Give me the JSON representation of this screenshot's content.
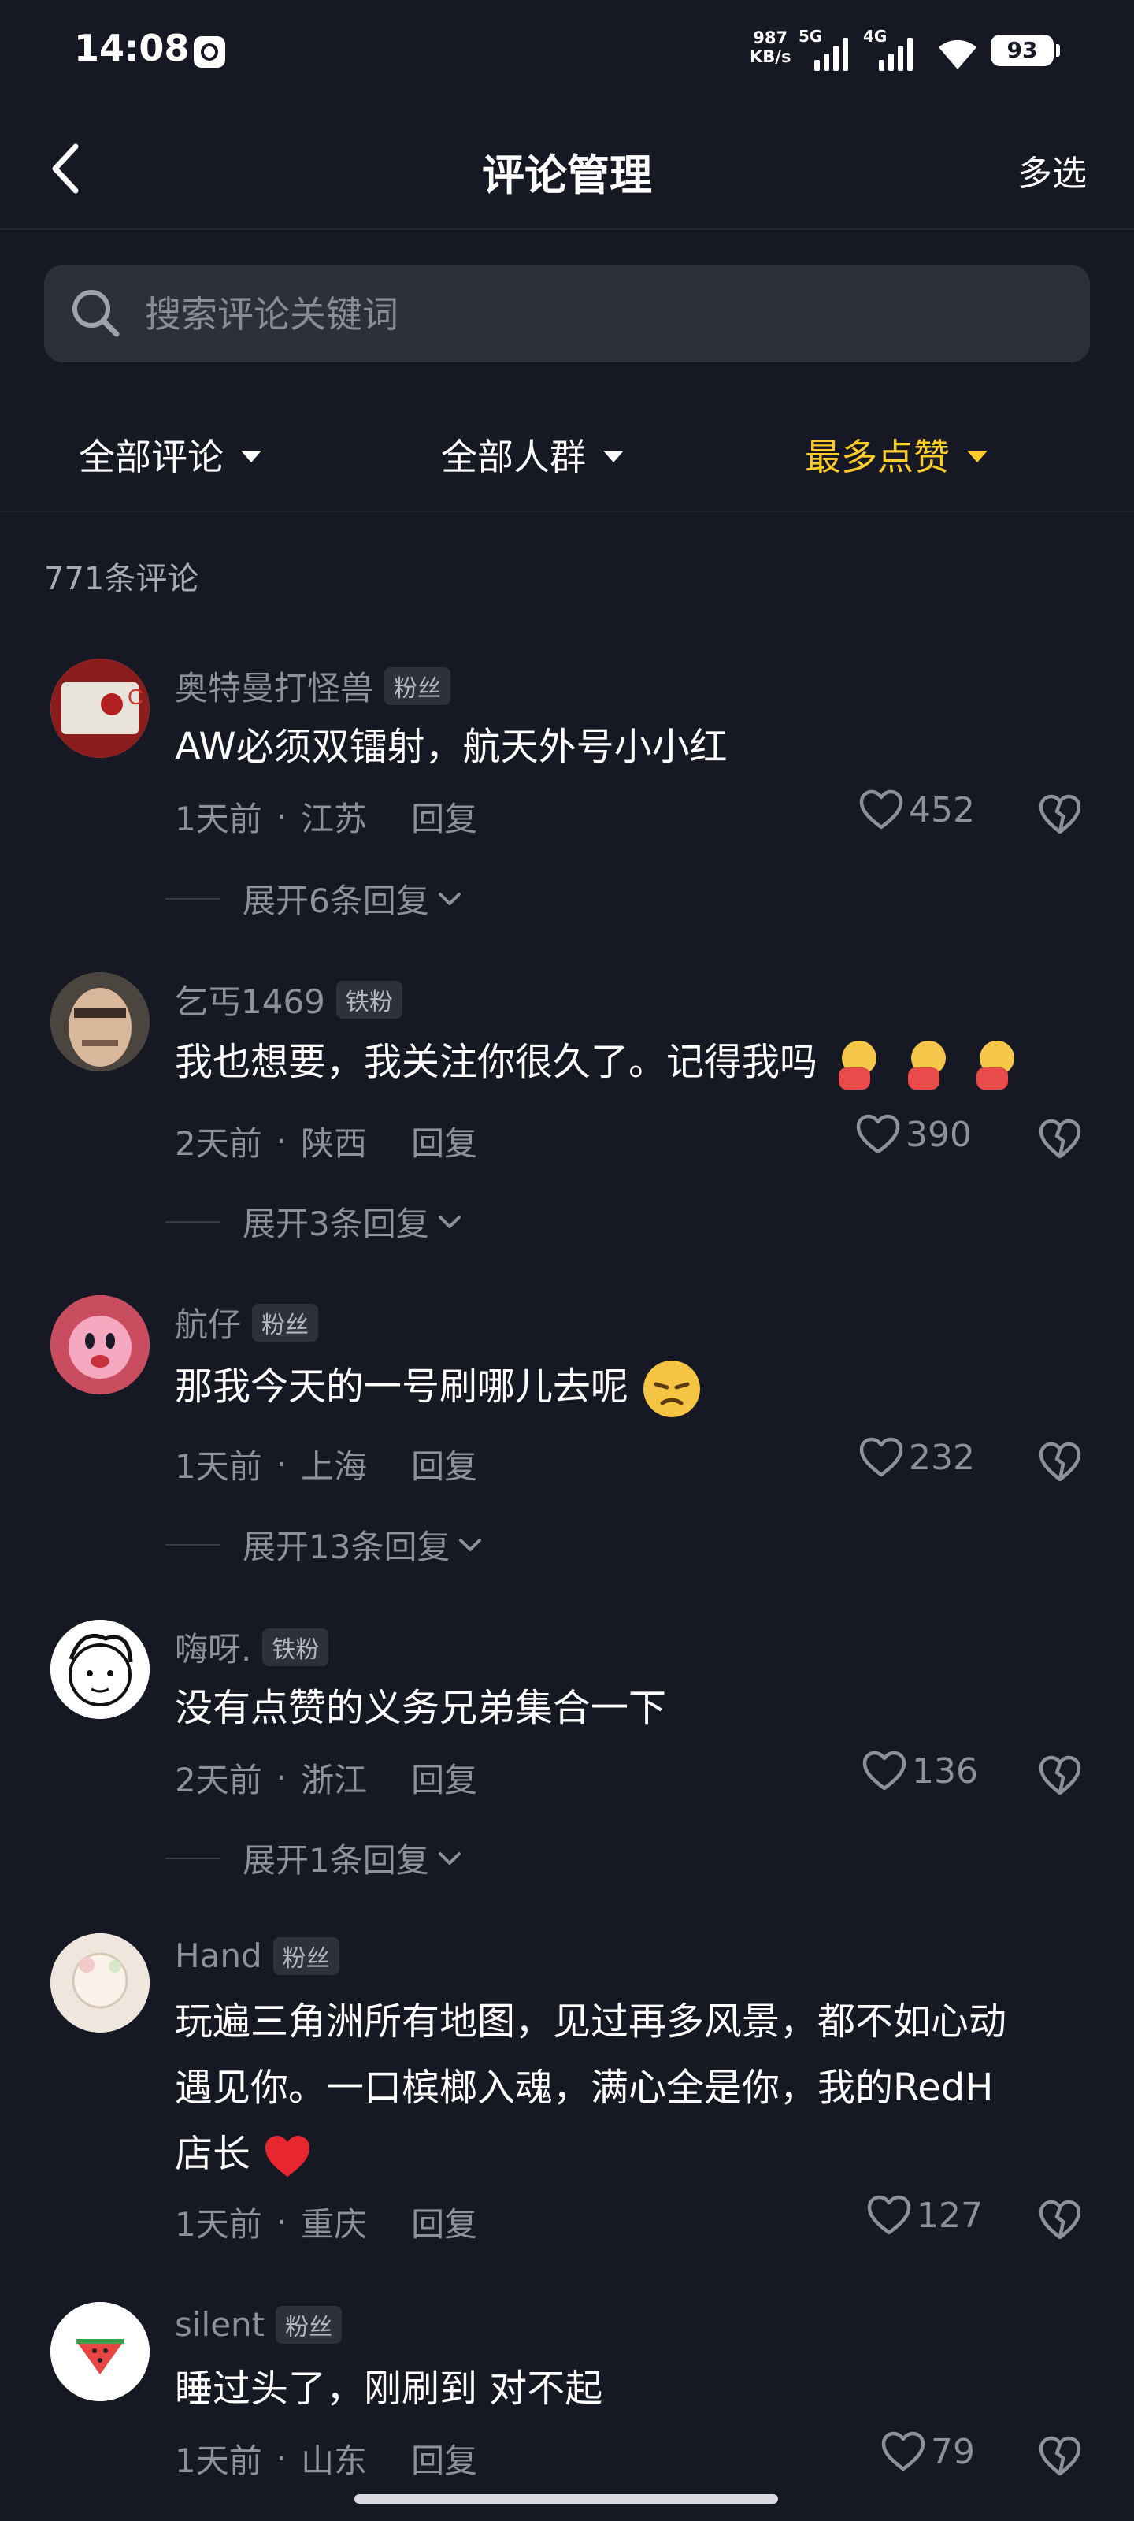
{
  "status_bar": {
    "time": "14:08",
    "net_speed_value": "987",
    "net_speed_unit": "KB/s",
    "signal1_label": "5G",
    "signal2_label": "4G",
    "battery": "93"
  },
  "header": {
    "title": "评论管理",
    "action": "多选",
    "back_icon": "chevron-left-icon"
  },
  "search": {
    "placeholder": "搜索评论关键词"
  },
  "filters": [
    {
      "label": "全部评论",
      "active": false
    },
    {
      "label": "全部人群",
      "active": false
    },
    {
      "label": "最多点赞",
      "active": true
    }
  ],
  "comment_count": "771条评论",
  "colors": {
    "background": "#161823",
    "accent": "#fdcb2a",
    "secondary_text": "#8f919a"
  },
  "comments": [
    {
      "user": "奥特曼打怪兽",
      "badge": "粉丝",
      "text": "AW必须双镭射，航天外号小小红",
      "time": "1天前",
      "location": "江苏",
      "reply_label": "回复",
      "likes": "452",
      "expand": "展开6条回复"
    },
    {
      "user": "乞丐1469",
      "badge": "铁粉",
      "text": "我也想要，我关注你很久了。记得我吗",
      "time": "2天前",
      "location": "陕西",
      "reply_label": "回复",
      "likes": "390",
      "expand": "展开3条回复"
    },
    {
      "user": "航仔",
      "badge": "粉丝",
      "text": "那我今天的一号刷哪儿去呢",
      "time": "1天前",
      "location": "上海",
      "reply_label": "回复",
      "likes": "232",
      "expand": "展开13条回复"
    },
    {
      "user": "嗨呀.",
      "badge": "铁粉",
      "text": "没有点赞的义务兄弟集合一下",
      "time": "2天前",
      "location": "浙江",
      "reply_label": "回复",
      "likes": "136",
      "expand": "展开1条回复"
    },
    {
      "user": "Hand",
      "badge": "粉丝",
      "text_line1": "玩遍三角洲所有地图，见过再多风景，都不如心动",
      "text_line2": "遇见你。一口槟榔入魂，满心全是你，我的RedH",
      "text_line3": "店长",
      "time": "1天前",
      "location": "重庆",
      "reply_label": "回复",
      "likes": "127"
    },
    {
      "user": "silent",
      "badge": "粉丝",
      "text": "睡过头了，刚刷到 对不起",
      "time": "1天前",
      "location": "山东",
      "reply_label": "回复",
      "likes": "79"
    }
  ],
  "meta_separator": "·"
}
